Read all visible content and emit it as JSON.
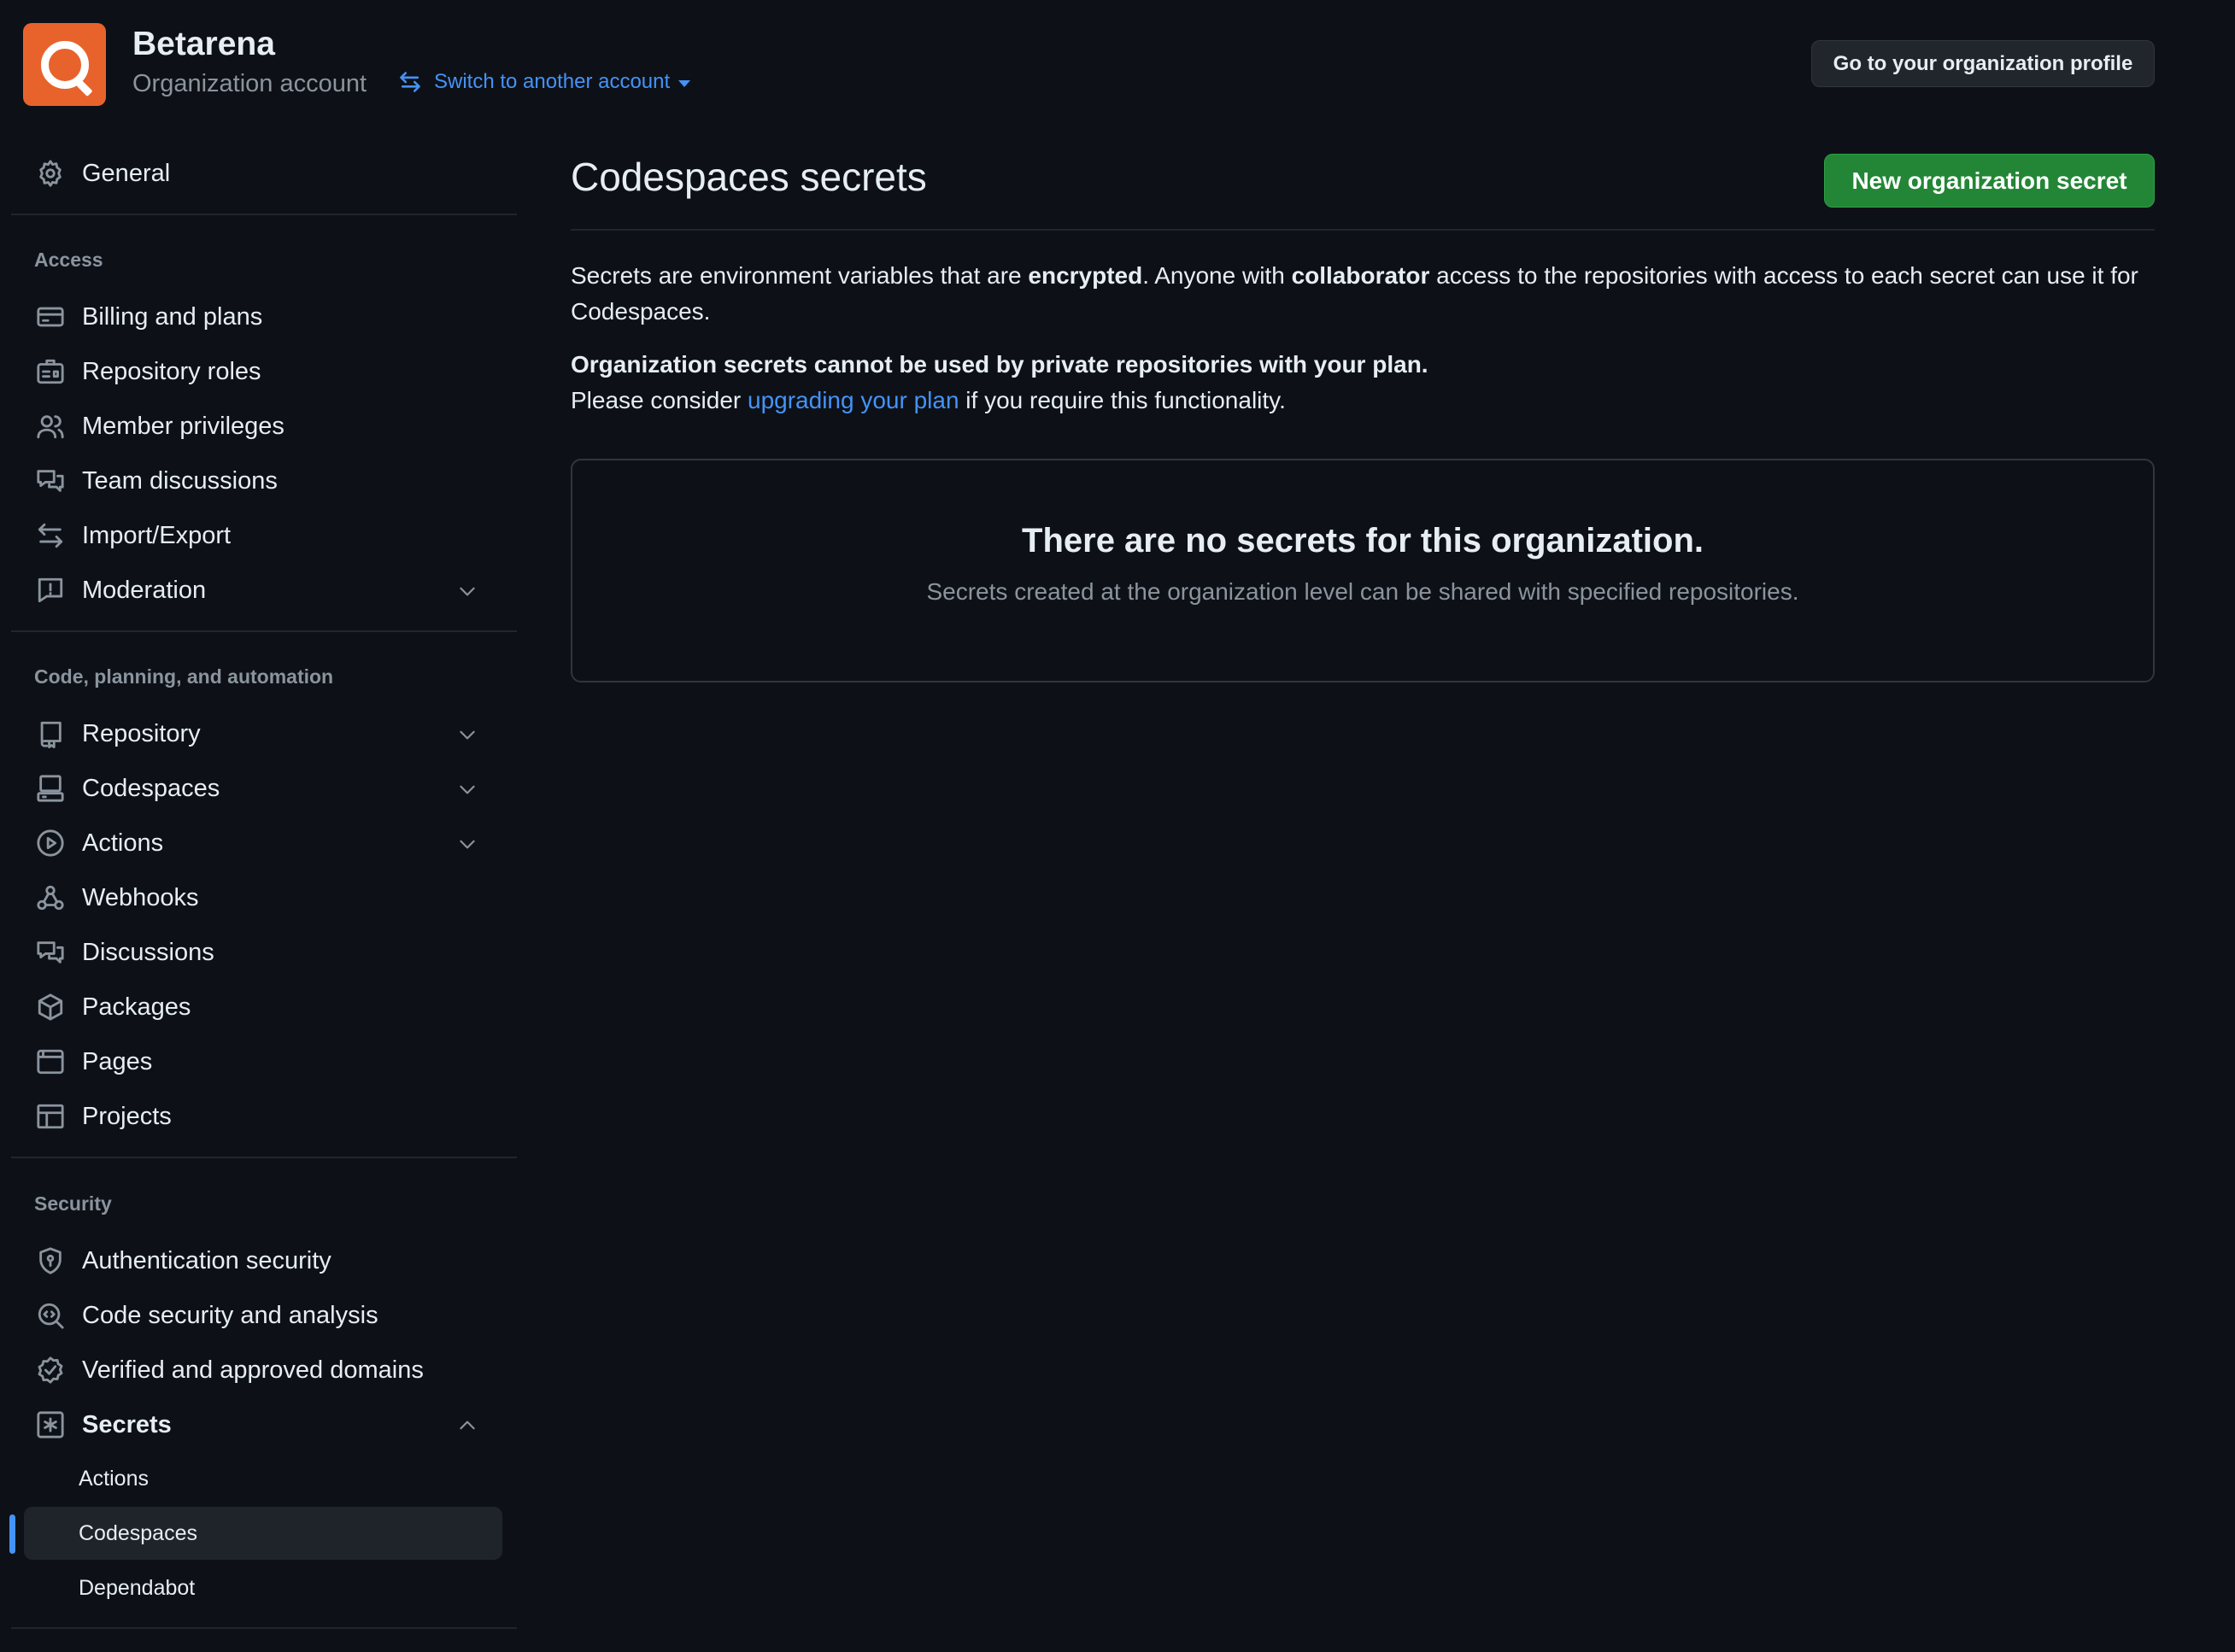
{
  "header": {
    "org_name": "Betarena",
    "org_type": "Organization account",
    "switch_label": "Switch to another account",
    "profile_button": "Go to your organization profile"
  },
  "sidebar": {
    "general": "General",
    "sections": {
      "access": "Access",
      "code": "Code, planning, and automation",
      "security": "Security"
    },
    "access_items": [
      "Billing and plans",
      "Repository roles",
      "Member privileges",
      "Team discussions",
      "Import/Export",
      "Moderation"
    ],
    "code_items": [
      "Repository",
      "Codespaces",
      "Actions",
      "Webhooks",
      "Discussions",
      "Packages",
      "Pages",
      "Projects"
    ],
    "security_items": [
      "Authentication security",
      "Code security and analysis",
      "Verified and approved domains",
      "Secrets"
    ],
    "secrets_sub": [
      "Actions",
      "Codespaces",
      "Dependabot"
    ],
    "active_item": "Codespaces"
  },
  "main": {
    "title": "Codespaces secrets",
    "new_button": "New organization secret",
    "desc1_a": "Secrets are environment variables that are ",
    "desc1_b": "encrypted",
    "desc1_c": ". Anyone with ",
    "desc1_d": "collaborator",
    "desc1_e": " access to the repositories with access to each secret can use it for Codespaces.",
    "notice_bold": "Organization secrets cannot be used by private repositories with your plan.",
    "notice_a": "Please consider ",
    "notice_link": "upgrading your plan",
    "notice_b": " if you require this functionality.",
    "empty_title": "There are no secrets for this organization.",
    "empty_sub": "Secrets created at the organization level can be shared with specified repositories."
  }
}
